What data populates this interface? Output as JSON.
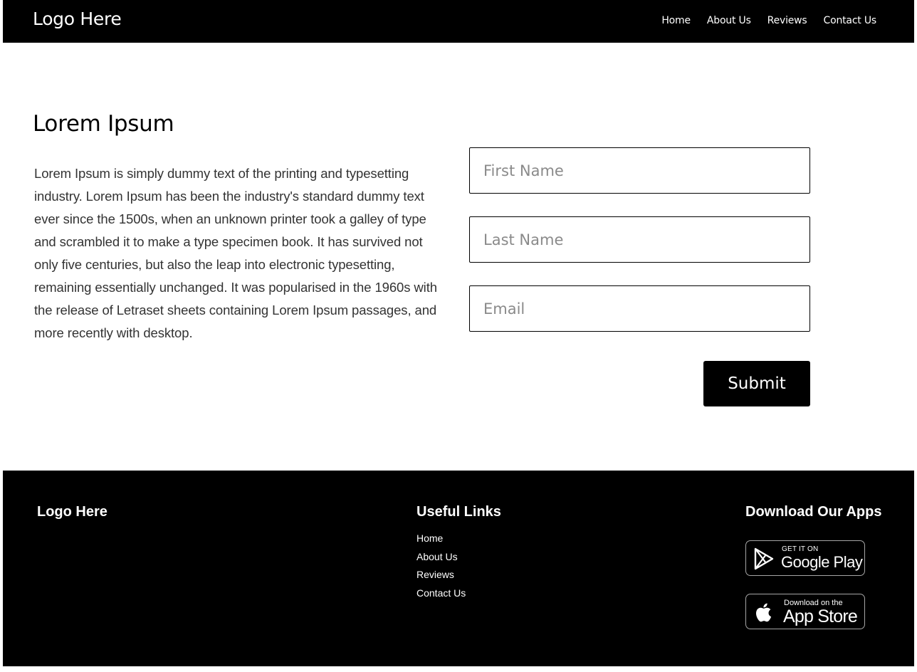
{
  "header": {
    "logo": "Logo Here",
    "nav": [
      "Home",
      "About Us",
      "Reviews",
      "Contact Us"
    ]
  },
  "main": {
    "title": "Lorem Ipsum",
    "body": "Lorem Ipsum is simply dummy text of the printing and typesetting industry. Lorem Ipsum has been the industry's standard dummy text ever since the 1500s, when an unknown printer took a galley of type and scrambled it to make a type specimen book. It has survived not only five centuries, but also the leap into electronic typesetting, remaining essentially unchanged. It was popularised in the 1960s with the release of Letraset sheets containing Lorem Ipsum passages, and more recently with desktop."
  },
  "form": {
    "first_name_placeholder": "First Name",
    "last_name_placeholder": "Last Name",
    "email_placeholder": "Email",
    "first_name_value": "",
    "last_name_value": "",
    "email_value": "",
    "submit_label": "Submit"
  },
  "footer": {
    "logo": "Logo Here",
    "links_title": "Useful Links",
    "links": [
      "Home",
      "About Us",
      "Reviews",
      "Contact Us"
    ],
    "apps_title": "Download Our Apps",
    "google_play": {
      "small": "GET IT ON",
      "big": "Google Play",
      "icon": "google-play-icon"
    },
    "app_store": {
      "small": "Download on the",
      "big": "App Store",
      "icon": "apple-icon"
    }
  },
  "colors": {
    "header_bg": "#000000",
    "footer_bg": "#000000",
    "page_bg": "#ffffff",
    "button_bg": "#000000",
    "text_muted": "#333333"
  }
}
